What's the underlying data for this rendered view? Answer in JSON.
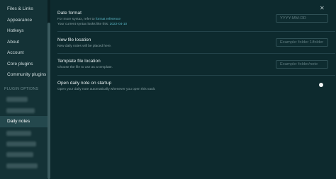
{
  "sidebar": {
    "items": [
      {
        "label": "Files & Links"
      },
      {
        "label": "Appearance"
      },
      {
        "label": "Hotkeys"
      },
      {
        "label": "About"
      },
      {
        "label": "Account"
      },
      {
        "label": "Core plugins"
      },
      {
        "label": "Community plugins"
      }
    ],
    "section_label": "PLUGIN OPTIONS",
    "active_item": "Daily notes"
  },
  "settings": {
    "date_format": {
      "title": "Date format",
      "desc_prefix": "For more syntax, refer to",
      "desc_link": "format reference",
      "preview_prefix": "Your current syntax looks like this:",
      "preview_value": "2022-04-10",
      "placeholder": "YYYY-MM-DD"
    },
    "file_location": {
      "title": "New file location",
      "desc": "New daily notes will be placed here.",
      "placeholder": "Example: folder 1/folder"
    },
    "template_location": {
      "title": "Template file location",
      "desc": "Choose the file to use as a template.",
      "placeholder": "Example: folder/note"
    },
    "open_on_startup": {
      "title": "Open daily note on startup",
      "desc": "Open your daily note automatically whenever you open this vault.",
      "enabled": true
    }
  },
  "icons": {
    "close": "close-icon"
  }
}
